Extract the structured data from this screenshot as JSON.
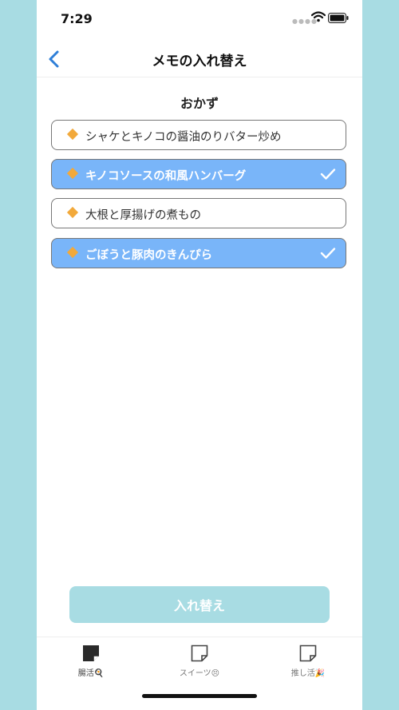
{
  "status_bar": {
    "time": "7:29"
  },
  "navbar": {
    "title": "メモの入れ替え",
    "back_icon": "chevron-left-icon"
  },
  "section": {
    "title": "おかず"
  },
  "items": [
    {
      "label": "シャケとキノコの醤油のりバター炒め",
      "selected": false
    },
    {
      "label": "キノコソースの和風ハンバーグ",
      "selected": true
    },
    {
      "label": "大根と厚揚げの煮もの",
      "selected": false
    },
    {
      "label": "ごぼうと豚肉のきんぴら",
      "selected": true
    }
  ],
  "swap_button": {
    "label": "入れ替え"
  },
  "tabs": [
    {
      "label": "腸活🍳",
      "icon": "note-icon-filled",
      "active": true
    },
    {
      "label": "スイーツ😣",
      "icon": "note-icon",
      "active": false
    },
    {
      "label": "推し活🎉",
      "icon": "note-icon",
      "active": false
    }
  ],
  "colors": {
    "background": "#a8dce3",
    "selected_item": "#79b5f9",
    "accent_diamond": "#f2a93b",
    "back_arrow": "#2f7fd8",
    "button": "#a8dce3"
  }
}
